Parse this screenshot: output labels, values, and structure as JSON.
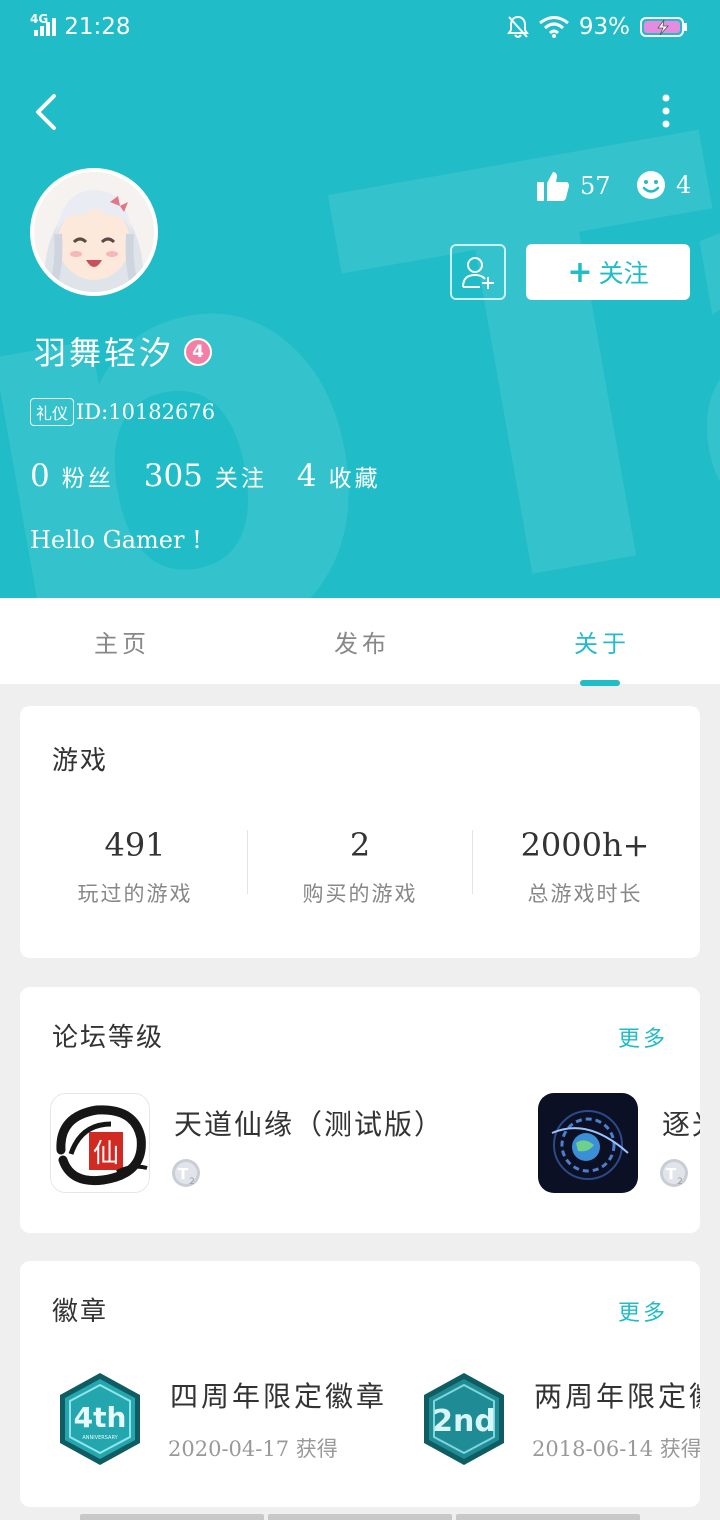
{
  "status_bar": {
    "network": "4G",
    "time": "21:28",
    "battery": "93%",
    "icons": [
      "signal-icon",
      "mute-bell-icon",
      "wifi-icon",
      "battery-charging-icon"
    ]
  },
  "header": {
    "background_color": "#20bdc8",
    "likes_count": "57",
    "smile_count": "4",
    "follow_button_label": "关注",
    "username": "羽舞轻汐",
    "level": "4",
    "level_badge_color": "#f37fa6",
    "etiquette_tag": "礼仪",
    "user_id": "ID:10182676",
    "counts": [
      {
        "value": "0",
        "label": "粉丝"
      },
      {
        "value": "305",
        "label": "关注"
      },
      {
        "value": "4",
        "label": "收藏"
      }
    ],
    "bio": "Hello Gamer !"
  },
  "tabs": [
    {
      "label": "主页",
      "active": false
    },
    {
      "label": "发布",
      "active": false
    },
    {
      "label": "关于",
      "active": true
    }
  ],
  "games_card": {
    "title": "游戏",
    "stats": [
      {
        "value": "491",
        "label": "玩过的游戏"
      },
      {
        "value": "2",
        "label": "购买的游戏"
      },
      {
        "value": "2000h+",
        "label": "总游戏时长"
      }
    ]
  },
  "forum_card": {
    "title": "论坛等级",
    "more_label": "更多",
    "items": [
      {
        "name": "天道仙缘（测试版）",
        "icon": "xian-calligraphy-game-icon",
        "level_icon": "level-t2-icon"
      },
      {
        "name": "逐光",
        "icon": "space-planet-game-icon",
        "level_icon": "level-t2-icon"
      }
    ]
  },
  "badges_card": {
    "title": "徽章",
    "more_label": "更多",
    "items": [
      {
        "name": "四周年限定徽章",
        "date": "2020-04-17 获得",
        "icon_text": "4th"
      },
      {
        "name": "两周年限定徽章",
        "date": "2018-06-14 获得",
        "icon_text": "2nd"
      }
    ]
  },
  "accent_color": "#20bdc8"
}
